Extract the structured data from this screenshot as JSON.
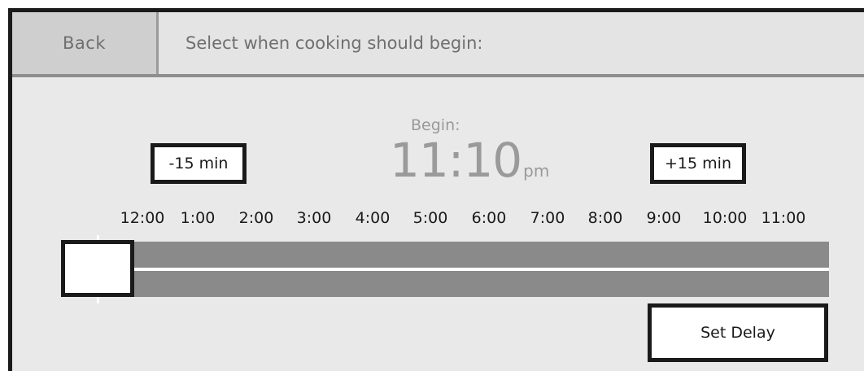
{
  "header": {
    "back_label": "Back",
    "title": "Select when cooking should begin:"
  },
  "begin": {
    "label": "Begin:",
    "time": "11:10",
    "ampm": "pm"
  },
  "buttons": {
    "minus_label": "-15 min",
    "plus_label": "+15 min",
    "set_delay_label": "Set Delay"
  },
  "timeline": {
    "hours": [
      "12:00",
      "1:00",
      "2:00",
      "3:00",
      "4:00",
      "5:00",
      "6:00",
      "7:00",
      "8:00",
      "9:00",
      "10:00",
      "11:00"
    ],
    "slider_value": 0
  }
}
